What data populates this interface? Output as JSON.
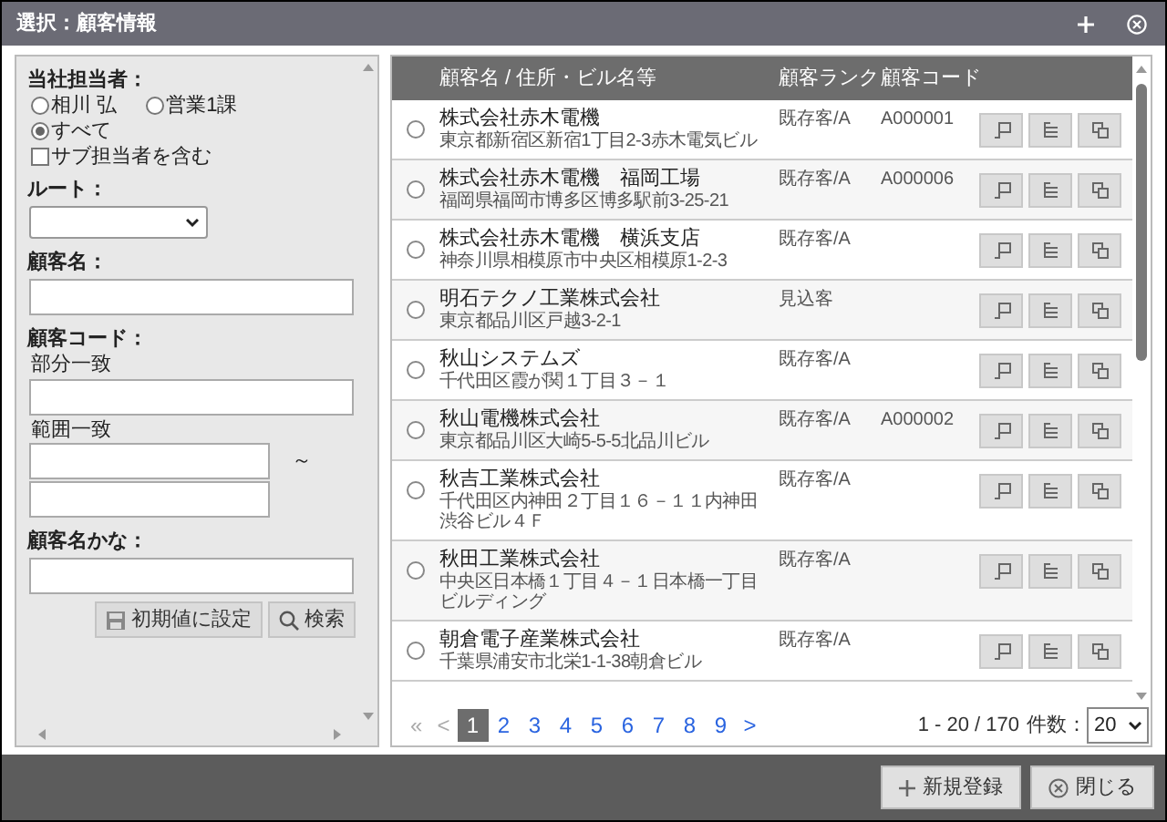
{
  "window": {
    "title": "選択：顧客情報"
  },
  "filters": {
    "staff_label": "当社担当者：",
    "staff_options": [
      {
        "label": "相川 弘",
        "selected": false
      },
      {
        "label": "営業1課",
        "selected": false
      },
      {
        "label": "すべて",
        "selected": true
      }
    ],
    "include_sub": {
      "label": "サブ担当者を含む",
      "checked": false
    },
    "route_label": "ルート：",
    "name_label": "顧客名：",
    "code_label": "顧客コード：",
    "partial_label": "部分一致",
    "range_label": "範囲一致",
    "range_sep": "～",
    "kana_label": "顧客名かな：",
    "buttons": [
      {
        "kind": "reset",
        "label": "初期値に設定"
      },
      {
        "kind": "search",
        "label": "検索"
      }
    ]
  },
  "table": {
    "columns": [
      "顧客名 / 住所・ビル名等",
      "顧客ランク",
      "顧客コード"
    ],
    "rows": [
      {
        "name": "株式会社赤木電機",
        "address": "東京都新宿区新宿1丁目2-3赤木電気ビル",
        "rank": "既存客/A",
        "code": "A000001",
        "selected": false
      },
      {
        "name": "株式会社赤木電機　福岡工場",
        "address": "福岡県福岡市博多区博多駅前3-25-21",
        "rank": "既存客/A",
        "code": "A000006",
        "selected": false
      },
      {
        "name": "株式会社赤木電機　横浜支店",
        "address": "神奈川県相模原市中央区相模原1-2-3",
        "rank": "既存客/A",
        "selected": false
      },
      {
        "name": "明石テクノ工業株式会社",
        "address": "東京都品川区戸越3-2-1",
        "rank": "見込客",
        "selected": false
      },
      {
        "name": "秋山システムズ",
        "address": "千代田区霞が関１丁目３－１",
        "rank": "既存客/A",
        "selected": false
      },
      {
        "name": "秋山電機株式会社",
        "address": "東京都品川区大崎5-5-5北品川ビル",
        "rank": "既存客/A",
        "code": "A000002",
        "selected": false
      },
      {
        "name": "秋吉工業株式会社",
        "address": "千代田区内神田２丁目１６－１１内神田渋谷ビル４Ｆ",
        "rank": "既存客/A",
        "selected": false
      },
      {
        "name": "秋田工業株式会社",
        "address": "中央区日本橋１丁目４－１日本橋一丁目ビルディング",
        "rank": "既存客/A",
        "selected": false
      },
      {
        "name": "朝倉電子産業株式会社",
        "address": "千葉県浦安市北栄1-1-38朝倉ビル",
        "rank": "既存客/A",
        "selected": false
      }
    ]
  },
  "pagination": {
    "first": "«",
    "prev": "<",
    "next": ">",
    "pages": [
      {
        "label": "1",
        "selected": true
      },
      {
        "label": "2",
        "selected": false
      },
      {
        "label": "3",
        "selected": false
      },
      {
        "label": "4",
        "selected": false
      },
      {
        "label": "5",
        "selected": false
      },
      {
        "label": "6",
        "selected": false
      },
      {
        "label": "7",
        "selected": false
      },
      {
        "label": "8",
        "selected": false
      },
      {
        "label": "9",
        "selected": false
      }
    ],
    "range": "1 - 20 / 170",
    "count_label": "件数：",
    "page_size": "20"
  },
  "footer_buttons": [
    {
      "kind": "new",
      "label": "新規登録"
    },
    {
      "kind": "close",
      "label": "閉じる"
    }
  ]
}
